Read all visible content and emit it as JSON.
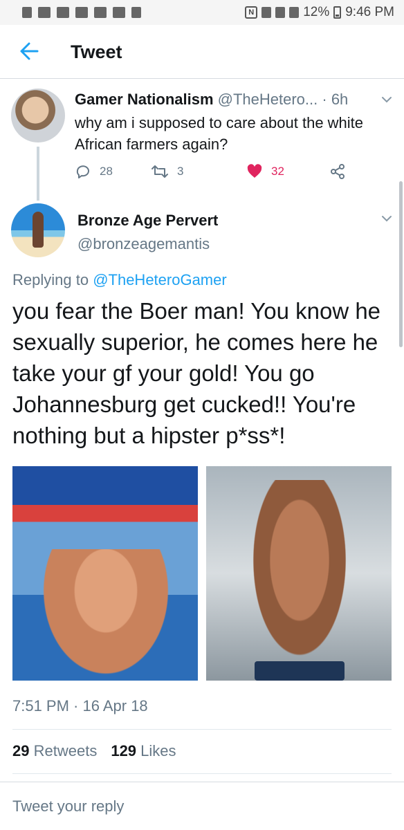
{
  "status_bar": {
    "battery": "12%",
    "time": "9:46 PM"
  },
  "app_bar": {
    "title": "Tweet"
  },
  "parent_tweet": {
    "name": "Gamer Nationalism",
    "handle": "@TheHetero...",
    "time": " · 6h",
    "text": "why am i supposed to care about the white African farmers again?",
    "replies": "28",
    "retweets": "3",
    "likes": "32",
    "like_color": "#e0245e"
  },
  "tweet": {
    "name": "Bronze Age Pervert",
    "handle": "@bronzeagemantis",
    "replying_prefix": "Replying to ",
    "replying_to": "@TheHeteroGamer",
    "text": "you fear the Boer man! You know he sexually superior, he comes here he take your gf your gold! You go Johannesburg get cucked!! You're nothing but a hipster p*ss*!",
    "timestamp": "7:51 PM · 16 Apr 18",
    "retweet_count": "29",
    "retweet_label": "Retweets",
    "like_count": "129",
    "like_label": "Likes"
  },
  "reply_box": {
    "placeholder": "Tweet your reply"
  },
  "colors": {
    "link": "#1da1f2",
    "secondary_text": "#657786"
  }
}
